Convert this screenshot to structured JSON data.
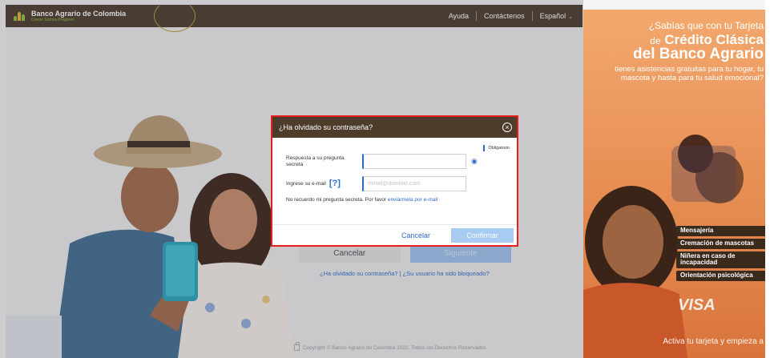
{
  "header": {
    "brand_title": "Banco Agrario de Colombia",
    "brand_tagline": "Crecer Somos Progreso",
    "nav": {
      "help": "Ayuda",
      "contact": "Contáctenos",
      "language": "Español"
    }
  },
  "login_background": {
    "cancel_label": "Cancelar",
    "next_label": "Siguiente",
    "links_text": "¿Ha olvidado su contraseña? | ¿Su usuario ha sido bloqueado?",
    "copyright": "Copyright © Banco Agrario de Colombia 2022. Todos los Derechos Reservados"
  },
  "modal": {
    "title": "¿Ha olvidado su contraseña?",
    "required_label": "Obligatorio",
    "secret_answer_label": "Respuesta a su pregunta secreta",
    "secret_answer_value": "",
    "email_label": "Ingrese su e-mail",
    "email_help": "[?]",
    "email_placeholder": "minail@dominio.com",
    "email_value": "",
    "forgot_text": "No recuerdo mi pregunta secreta. Por favor",
    "forgot_link": "enviármela por e-mail",
    "cancel_label": "Cancelar",
    "confirm_label": "Confirmar"
  },
  "ad": {
    "line1": "¿Sabías que con tu Tarjeta",
    "line2_prefix": "de",
    "line2": "Crédito Clásica",
    "line3": "del Banco Agrario",
    "line4": "tienes asistencias gratuitas para tu hogar, tu mascota y hasta para tu salud emocional?",
    "badges": [
      "Mensajería",
      "Cremación de mascotas",
      "Niñera en caso de incapacidad",
      "Orientación psicológica"
    ],
    "card_brand": "VISA",
    "footer": "Activa tu tarjeta y empieza a"
  },
  "colors": {
    "header_brown": "#4b3b2b",
    "modal_head": "#4e3c2b",
    "link_blue": "#2d6bc9",
    "highlight_red": "#e81d1d",
    "confirm_disabled": "#a8cbf1"
  }
}
